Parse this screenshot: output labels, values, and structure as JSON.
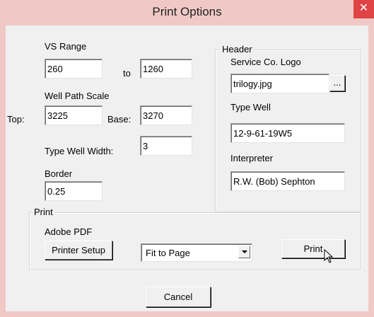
{
  "window": {
    "title": "Print Options",
    "close_glyph": "✕",
    "accent": "#f0c9c6",
    "close_color": "#e04343"
  },
  "vs_range": {
    "label": "VS Range",
    "from_value": "260",
    "to_label": "to",
    "to_value": "1260"
  },
  "well_path_scale": {
    "label": "Well Path Scale",
    "top_label": "Top:",
    "top_value": "3225",
    "base_label": "Base:",
    "base_value": "3270"
  },
  "type_well_width": {
    "label": "Type Well Width:",
    "value": "3"
  },
  "border": {
    "label": "Border",
    "value": "0.25"
  },
  "header_group": {
    "label": "Header",
    "logo_label": "Service Co. Logo",
    "logo_value": "trilogy.jpg",
    "browse_label": "...",
    "type_well_label": "Type Well",
    "type_well_value": "12-9-61-19W5",
    "interpreter_label": "Interpreter",
    "interpreter_value": "R.W. (Bob) Sephton"
  },
  "print_group": {
    "label": "Print",
    "adobe_label": "Adobe PDF",
    "printer_setup_label": "Printer Setup",
    "fit_selected": "Fit to Page",
    "print_label": "Print"
  },
  "footer": {
    "cancel_label": "Cancel"
  },
  "icons": {
    "close": "close-icon",
    "combo_arrow": "chevron-down-icon",
    "cursor": "mouse-pointer-icon"
  }
}
